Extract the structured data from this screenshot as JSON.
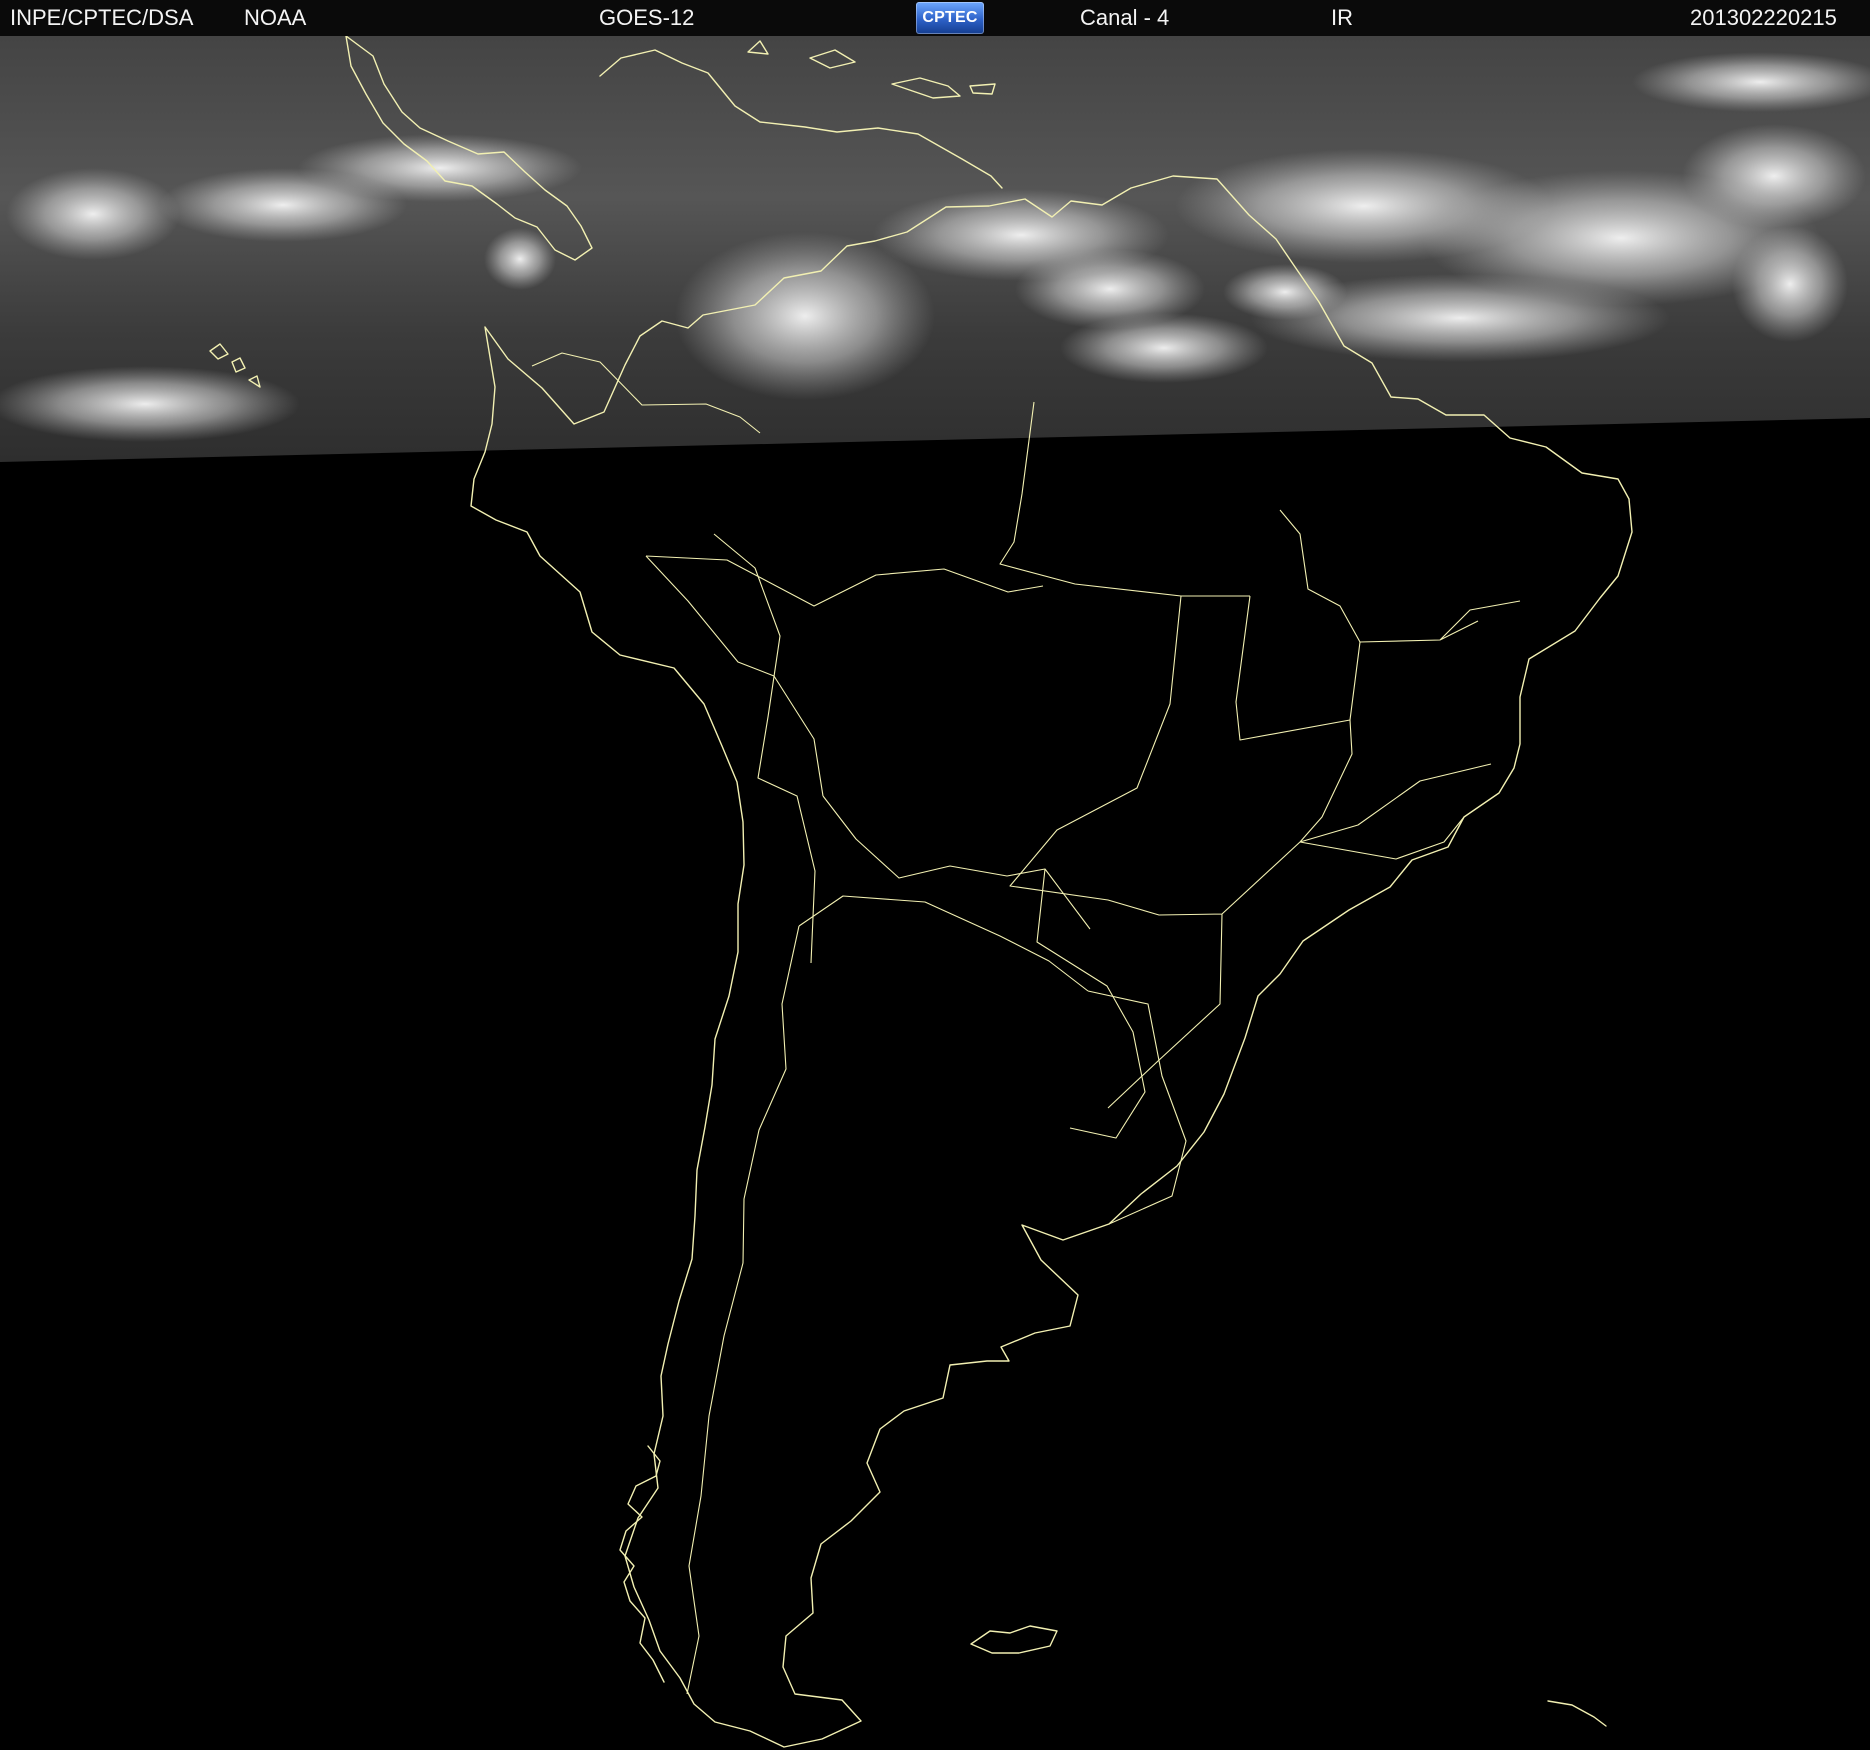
{
  "header": {
    "source": "INPE/CPTEC/DSA",
    "agency": "NOAA",
    "satellite": "GOES-12",
    "logo": "CPTEC",
    "channel": "Canal - 4",
    "band": "IR",
    "timestamp": "201302220215"
  },
  "map": {
    "background_color": "#000000",
    "coastline_color": "#f2f0b2",
    "cloud_color": "#ffffff"
  }
}
